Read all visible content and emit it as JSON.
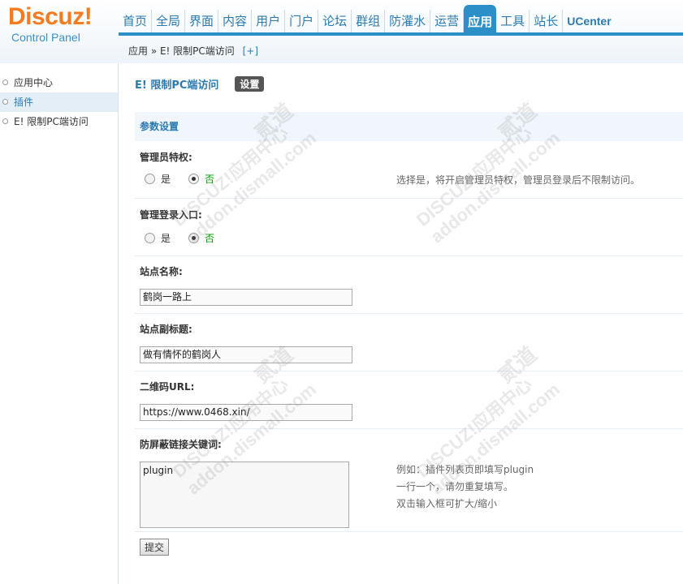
{
  "header": {
    "logo_main": "Discuz!",
    "logo_sub": "Control Panel",
    "nav": [
      "首页",
      "全局",
      "界面",
      "内容",
      "用户",
      "门户",
      "论坛",
      "群组",
      "防灌水",
      "运营",
      "应用",
      "工具",
      "站长",
      "UCenter"
    ],
    "active_nav": "应用",
    "breadcrumb": "应用 » E! 限制PC端访问",
    "breadcrumb_add": "[+]"
  },
  "sidebar": {
    "items": [
      {
        "label": "应用中心"
      },
      {
        "label": "插件"
      },
      {
        "label": "E! 限制PC端访问"
      }
    ],
    "active": "插件"
  },
  "main": {
    "title": "E! 限制PC端访问",
    "settings_button": "设置",
    "section_title": "参数设置",
    "admin_privilege": {
      "label": "管理员特权:",
      "yes": "是",
      "no": "否",
      "selected": "否",
      "tip": "选择是，将开启管理员特权，管理员登录后不限制访问。"
    },
    "admin_login": {
      "label": "管理登录入口:",
      "yes": "是",
      "no": "否",
      "selected": "否"
    },
    "site_name": {
      "label": "站点名称:",
      "value": "鹤岗一路上"
    },
    "site_subtitle": {
      "label": "站点副标题:",
      "value": "做有情怀的鹤岗人"
    },
    "qr_url": {
      "label": "二维码URL:",
      "value": "https://www.0468.xin/"
    },
    "keywords": {
      "label": "防屏蔽链接关键词:",
      "value": "plugin",
      "tips": [
        "例如：插件列表页即填写plugin",
        "一行一个，请勿重复填写。",
        "双击输入框可扩大/缩小"
      ]
    },
    "submit_label": "提交"
  },
  "watermark": {
    "line1": "DISCUZ!应用中心",
    "line2": "addon.dismall.com",
    "line3": "贰道"
  },
  "colors": {
    "accent": "#2d8fc7",
    "logo": "#f47b20",
    "selected": "#009900"
  }
}
